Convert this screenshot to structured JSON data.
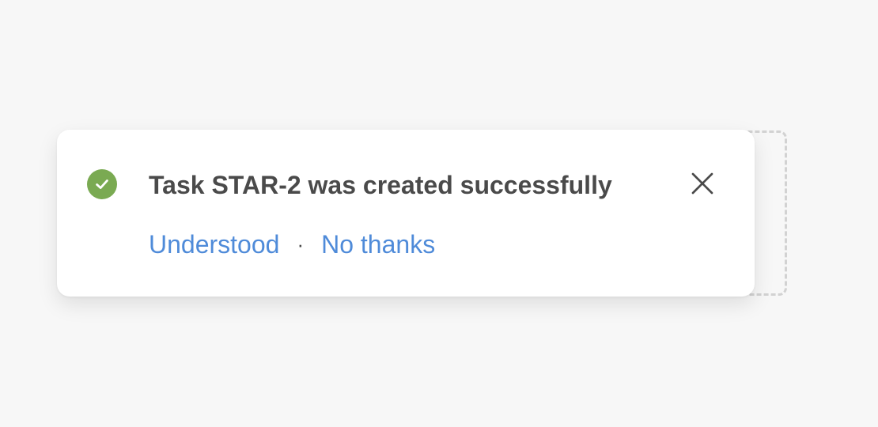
{
  "toast": {
    "status": "success",
    "icon": "check-circle-icon",
    "message": "Task STAR-2 was created successfully",
    "close_icon": "close-icon",
    "actions": {
      "primary_label": "Understood",
      "separator": "·",
      "secondary_label": "No thanks"
    }
  },
  "colors": {
    "page_background": "#f7f7f7",
    "toast_background": "#ffffff",
    "success": "#7aaa52",
    "link": "#4f8bd9",
    "text": "#4a4a4a",
    "dashed_outline": "#d2d2d2"
  }
}
